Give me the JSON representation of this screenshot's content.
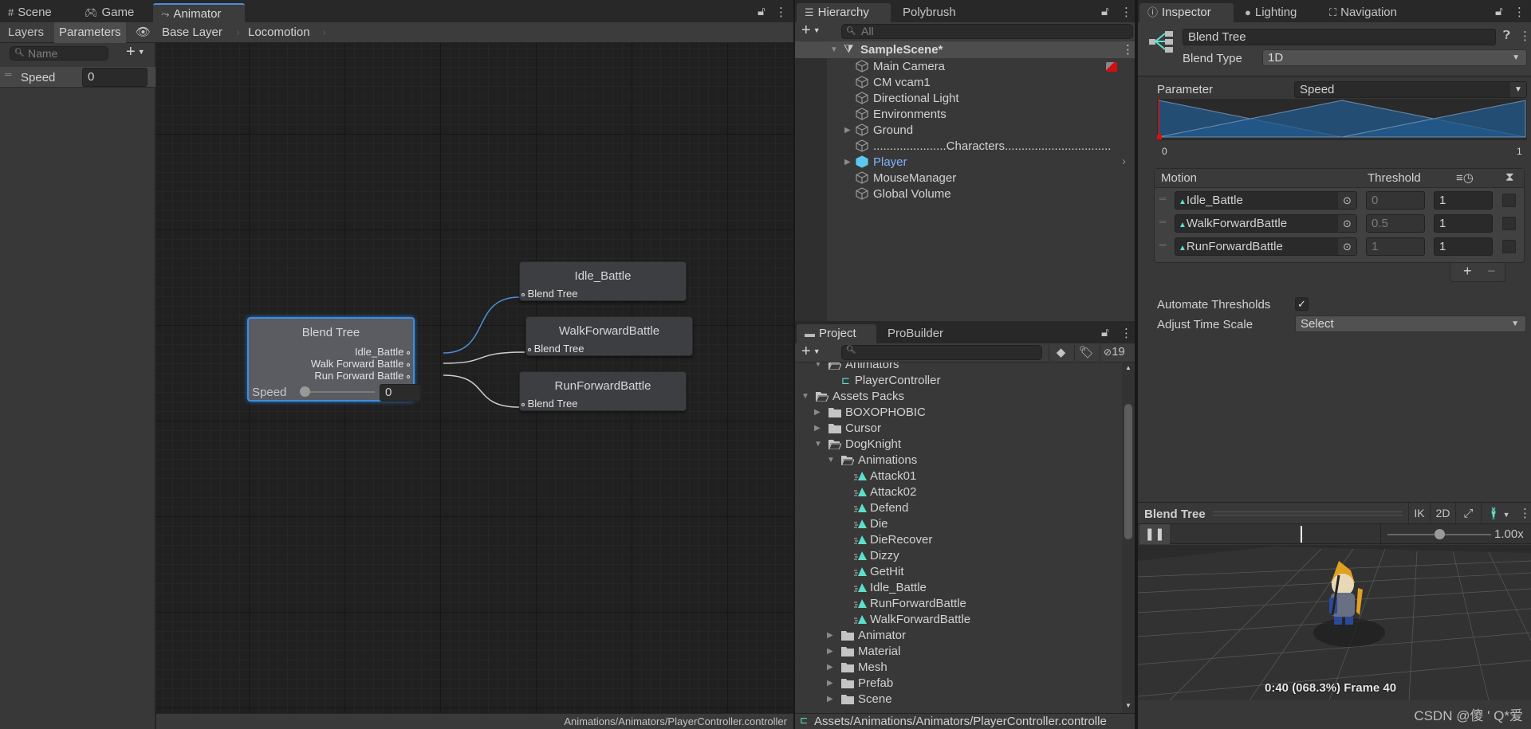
{
  "animator_window": {
    "tabs": [
      {
        "label": "Scene",
        "icon": "grid-icon"
      },
      {
        "label": "Game",
        "icon": "gamepad-icon"
      },
      {
        "label": "Animator",
        "icon": "animator-icon"
      }
    ],
    "sub_tabs": {
      "layers": "Layers",
      "parameters": "Parameters"
    },
    "breadcrumb": [
      "Base Layer",
      "Locomotion"
    ],
    "search_placeholder": "Name",
    "parameters": [
      {
        "name": "Speed",
        "value": "0"
      }
    ],
    "graph": {
      "blend_tree_node": {
        "title": "Blend Tree",
        "outputs": [
          "Idle_Battle",
          "Walk Forward Battle",
          "Run Forward Battle"
        ],
        "slider_label": "Speed",
        "slider_value": "0",
        "slider_fraction": 0
      },
      "motion_nodes": [
        {
          "title": "Idle_Battle",
          "input": "Blend Tree"
        },
        {
          "title": "WalkForwardBattle",
          "input": "Blend Tree"
        },
        {
          "title": "RunForwardBattle",
          "input": "Blend Tree"
        }
      ]
    },
    "status_path": "Animations/Animators/PlayerController.controller"
  },
  "hierarchy": {
    "tabs": [
      "Hierarchy",
      "Polybrush"
    ],
    "search_placeholder": "All",
    "scene_name": "SampleScene*",
    "items": [
      {
        "label": "Main Camera",
        "expandable": false
      },
      {
        "label": "CM vcam1",
        "expandable": false
      },
      {
        "label": "Directional Light",
        "expandable": false
      },
      {
        "label": "Environments",
        "expandable": false
      },
      {
        "label": "Ground",
        "expandable": true
      },
      {
        "label": "......................Characters................................",
        "expandable": false
      },
      {
        "label": "Player",
        "expandable": true,
        "prefab": true
      },
      {
        "label": "MouseManager",
        "expandable": false
      },
      {
        "label": "Global Volume",
        "expandable": false
      }
    ]
  },
  "project": {
    "tabs": [
      "Project",
      "ProBuilder"
    ],
    "hidden_count": "19",
    "tree": [
      {
        "label": "Animators",
        "type": "folder-open",
        "depth": 1,
        "expanded": true
      },
      {
        "label": "PlayerController",
        "type": "controller",
        "depth": 2
      },
      {
        "label": "Assets Packs",
        "type": "folder-open",
        "depth": 0,
        "expanded": true
      },
      {
        "label": "BOXOPHOBIC",
        "type": "folder",
        "depth": 1,
        "collapsed": true
      },
      {
        "label": "Cursor",
        "type": "folder",
        "depth": 1,
        "collapsed": true
      },
      {
        "label": "DogKnight",
        "type": "folder-open",
        "depth": 1,
        "expanded": true
      },
      {
        "label": "Animations",
        "type": "folder-open",
        "depth": 2,
        "expanded": true
      },
      {
        "label": "Attack01",
        "type": "anim",
        "depth": 3
      },
      {
        "label": "Attack02",
        "type": "anim",
        "depth": 3
      },
      {
        "label": "Defend",
        "type": "anim",
        "depth": 3
      },
      {
        "label": "Die",
        "type": "anim",
        "depth": 3
      },
      {
        "label": "DieRecover",
        "type": "anim",
        "depth": 3
      },
      {
        "label": "Dizzy",
        "type": "anim",
        "depth": 3
      },
      {
        "label": "GetHit",
        "type": "anim",
        "depth": 3
      },
      {
        "label": "Idle_Battle",
        "type": "anim",
        "depth": 3
      },
      {
        "label": "RunForwardBattle",
        "type": "anim",
        "depth": 3
      },
      {
        "label": "WalkForwardBattle",
        "type": "anim",
        "depth": 3
      },
      {
        "label": "Animator",
        "type": "folder",
        "depth": 2,
        "collapsed": true
      },
      {
        "label": "Material",
        "type": "folder",
        "depth": 2,
        "collapsed": true
      },
      {
        "label": "Mesh",
        "type": "folder",
        "depth": 2,
        "collapsed": true
      },
      {
        "label": "Prefab",
        "type": "folder",
        "depth": 2,
        "collapsed": true
      },
      {
        "label": "Scene",
        "type": "folder",
        "depth": 2,
        "collapsed": true
      }
    ],
    "status_path": "Assets/Animations/Animators/PlayerController.controlle"
  },
  "inspector": {
    "tabs": [
      {
        "label": "Inspector",
        "icon": "info-icon"
      },
      {
        "label": "Lighting",
        "icon": "bulb-icon"
      },
      {
        "label": "Navigation",
        "icon": "navigation-icon"
      }
    ],
    "object_name": "Blend Tree",
    "blend_type_label": "Blend Type",
    "blend_type_value": "1D",
    "parameter_label": "Parameter",
    "parameter_value": "Speed",
    "graph_min": "0",
    "graph_max": "1",
    "graph_marker_value": 0,
    "motion_header": "Motion",
    "threshold_header": "Threshold",
    "motions": [
      {
        "name": "Idle_Battle",
        "threshold": "0",
        "time_scale": "1",
        "mirror": false
      },
      {
        "name": "WalkForwardBattle",
        "threshold": "0.5",
        "time_scale": "1",
        "mirror": false
      },
      {
        "name": "RunForwardBattle",
        "threshold": "1",
        "time_scale": "1",
        "mirror": false
      }
    ],
    "automate_label": "Automate Thresholds",
    "automate_checked": true,
    "adjust_label": "Adjust Time Scale",
    "adjust_value": "Select",
    "preview": {
      "title": "Blend Tree",
      "ik": "IK",
      "twod": "2D",
      "speed": "1.00x",
      "speed_fraction": 0.5,
      "timeline_fraction": 0.683,
      "info": "0:40 (068.3%) Frame 40"
    },
    "watermark": "CSDN @傻 ' Q*爱"
  },
  "colors": {
    "accent": "#4a90d9",
    "anim_teal": "#5ce0cc",
    "player_blue": "#7fb2ff",
    "blend_fill": "#215a8c",
    "marker_red": "#e01010"
  }
}
